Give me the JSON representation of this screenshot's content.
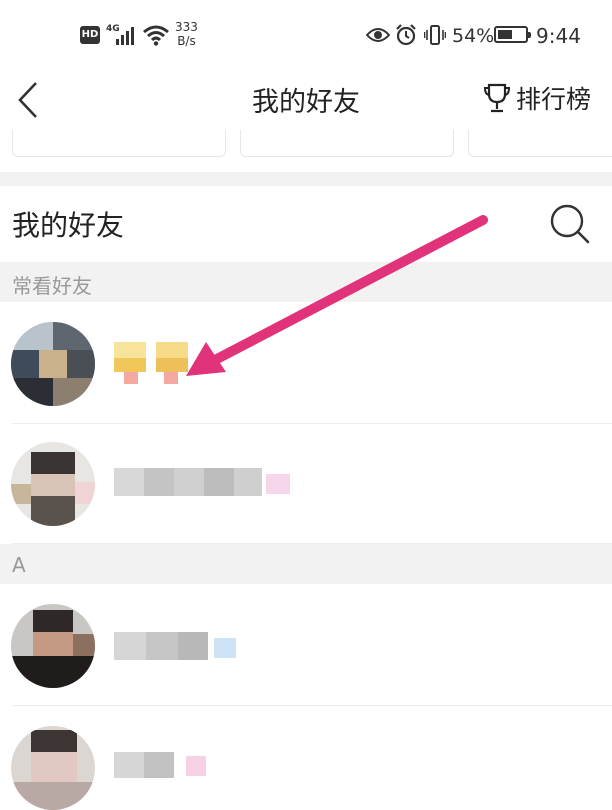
{
  "status_bar": {
    "hd": "HD",
    "network": "4G",
    "speed_value": "333",
    "speed_unit": "B/s",
    "battery_percent": "54%",
    "battery_level": 0.54,
    "time": "9:44",
    "icons": [
      "hd-icon",
      "signal-icon",
      "wifi-icon",
      "eye-icon",
      "alarm-icon",
      "vibrate-icon",
      "battery-icon"
    ]
  },
  "nav": {
    "title": "我的好友",
    "back_icon": "chevron-left-icon",
    "ranking_label": "排行榜",
    "ranking_icon": "trophy-icon"
  },
  "friends": {
    "title": "我的好友",
    "search_icon": "search-icon",
    "sections": [
      {
        "label": "常看好友"
      },
      {
        "label": "A"
      }
    ]
  },
  "colors": {
    "accent_red": "#e53935",
    "annotation_arrow": "#e0337a",
    "section_bg": "#f2f2f2",
    "section_text": "#999999"
  }
}
